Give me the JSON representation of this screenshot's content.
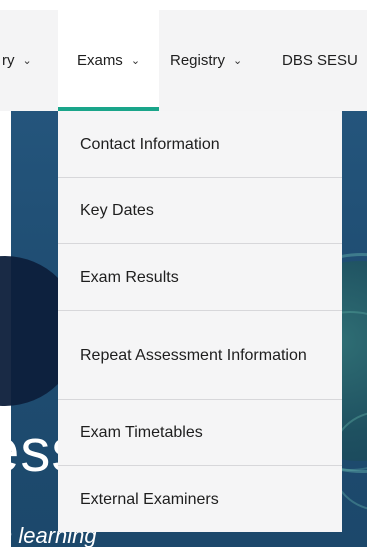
{
  "nav": {
    "items": [
      {
        "label": "ry",
        "has_chevron": true
      },
      {
        "label": "Exams",
        "has_chevron": true,
        "active": true
      },
      {
        "label": "Registry",
        "has_chevron": true
      },
      {
        "label": "DBS SESU",
        "has_chevron": false
      }
    ],
    "chevron": "⌄",
    "accent_color": "#1aa58a"
  },
  "dropdown": {
    "items": [
      {
        "label": "Contact Information"
      },
      {
        "label": "Key Dates"
      },
      {
        "label": "Exam Results"
      },
      {
        "label": "Repeat Assessment Information"
      },
      {
        "label": "Exam Timetables"
      },
      {
        "label": "External Examiners"
      }
    ]
  },
  "hero": {
    "title": "ess School",
    "subtitle": "h learning"
  }
}
